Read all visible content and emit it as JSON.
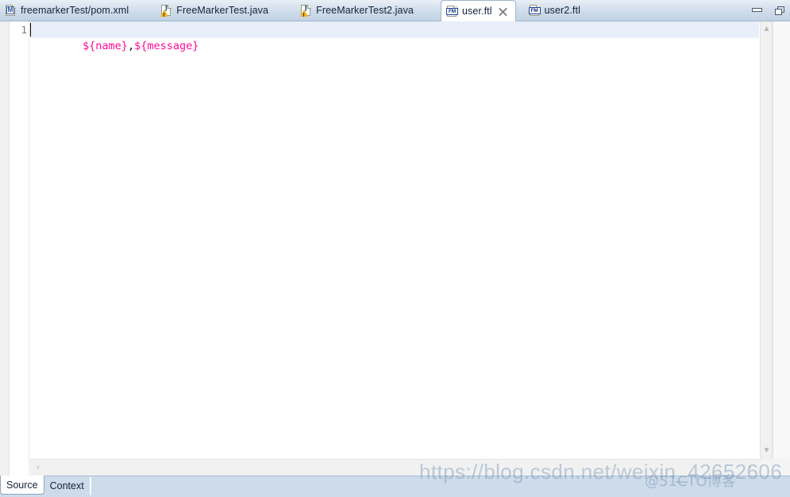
{
  "window": {
    "minimize_title": "Minimize",
    "maximize_title": "Maximize"
  },
  "editor_tabs": [
    {
      "label": "freemarkerTest/pom.xml",
      "icon": "maven-file-icon",
      "active": false,
      "closable": false
    },
    {
      "label": "FreeMarkerTest.java",
      "icon": "java-file-warning-icon",
      "active": false,
      "closable": false
    },
    {
      "label": "FreeMarkerTest2.java",
      "icon": "java-file-warning-icon",
      "active": false,
      "closable": false
    },
    {
      "label": "user.ftl",
      "icon": "freemarker-file-icon",
      "active": true,
      "closable": true
    },
    {
      "label": "user2.ftl",
      "icon": "freemarker-file-icon",
      "active": false,
      "closable": false
    }
  ],
  "editor": {
    "line_number": "1",
    "code": {
      "expr_name": "${name}",
      "separator": ",",
      "expr_message": "${message}"
    },
    "scroll": {
      "up_arrow": "▲",
      "down_arrow": "▼",
      "left_arrow": "‹",
      "right_arrow": "›"
    }
  },
  "bottom_tabs": [
    {
      "label": "Source",
      "active": true
    },
    {
      "label": "Context",
      "active": false
    }
  ],
  "watermark": {
    "url": "https://blog.csdn.net/weixin_42652606",
    "site": "@51CTO博客"
  },
  "colors": {
    "tab_bar_bg": "#c2d3e4",
    "active_tab_bg": "#ffffff",
    "current_line_highlight": "#e8effa",
    "expression_token": "#ff0a96",
    "bottom_bar_bg": "#cddbea"
  }
}
